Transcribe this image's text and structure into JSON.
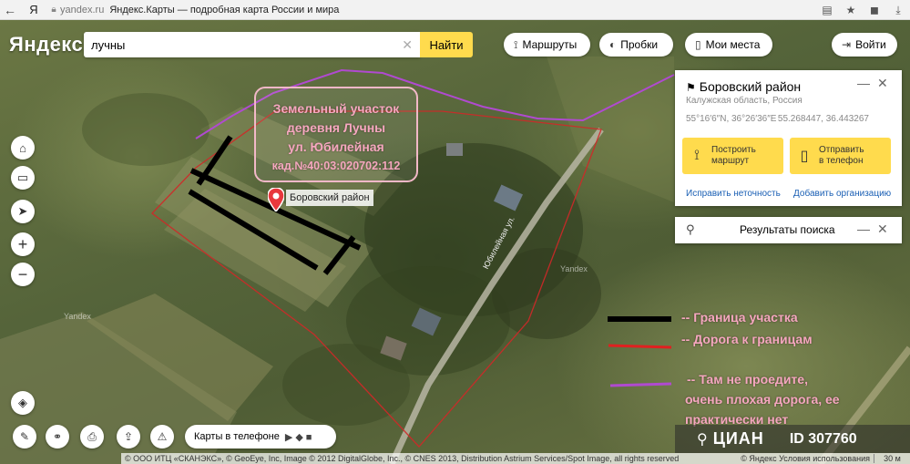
{
  "browser": {
    "back_icon": "back-arrow-icon",
    "yandex_letter": "Я",
    "domain": "yandex.ru",
    "page_title": "Яндекс.Карты — подробная карта России и мира"
  },
  "header": {
    "logo": "Яндекс",
    "search_value": "лучны",
    "search_button": "Найти",
    "routes": "Маршруты",
    "traffic": "Пробки",
    "my_places": "Мои места",
    "login": "Войти"
  },
  "place_card": {
    "title": "Боровский район",
    "subtitle": "Калужская область, Россия",
    "coords_dms": "55°16′6″N, 36°26′36″E",
    "coords_decimal": "55.268447, 36.443267",
    "route_button_line1": "Построить",
    "route_button_line2": "маршрут",
    "phone_button_line1": "Отправить",
    "phone_button_line2": "в телефон",
    "fix_link": "Исправить неточность",
    "add_org_link": "Добавить организацию"
  },
  "results_card": {
    "title": "Результаты поиска"
  },
  "annotation": {
    "line1": "Земельный участок",
    "line2": "деревня Лучны",
    "line3": "ул. Юбилейная",
    "line4": "кад.№40:03:020702:112"
  },
  "marker_label": "Боровский район",
  "road_label": "Юбилейная ул.",
  "watermark": "Yandex",
  "legend": {
    "boundary": "-- Граница участка",
    "road": "-- Дорога к границам",
    "bad_road_line1": "-- Там не проедите,",
    "bad_road_line2": "очень плохая дорога, ее",
    "bad_road_line3": "практически нет",
    "colors": {
      "boundary": "#000000",
      "road": "#e02020",
      "bad_road": "#b04ad0"
    }
  },
  "bottom": {
    "phone_maps": "Карты в телефоне",
    "copyright": "© ООО ИТЦ «СКАНЭКС», © GeoEye, Inc, Image © 2012 DigitalGlobe, Inc., © CNES 2013, Distribution Astrium Services/Spot Image, all rights reserved",
    "terms": "© Яндекс Условия использования",
    "scale": "30 м"
  },
  "cian": {
    "name": "ЦИАН",
    "id": "ID 307760"
  }
}
